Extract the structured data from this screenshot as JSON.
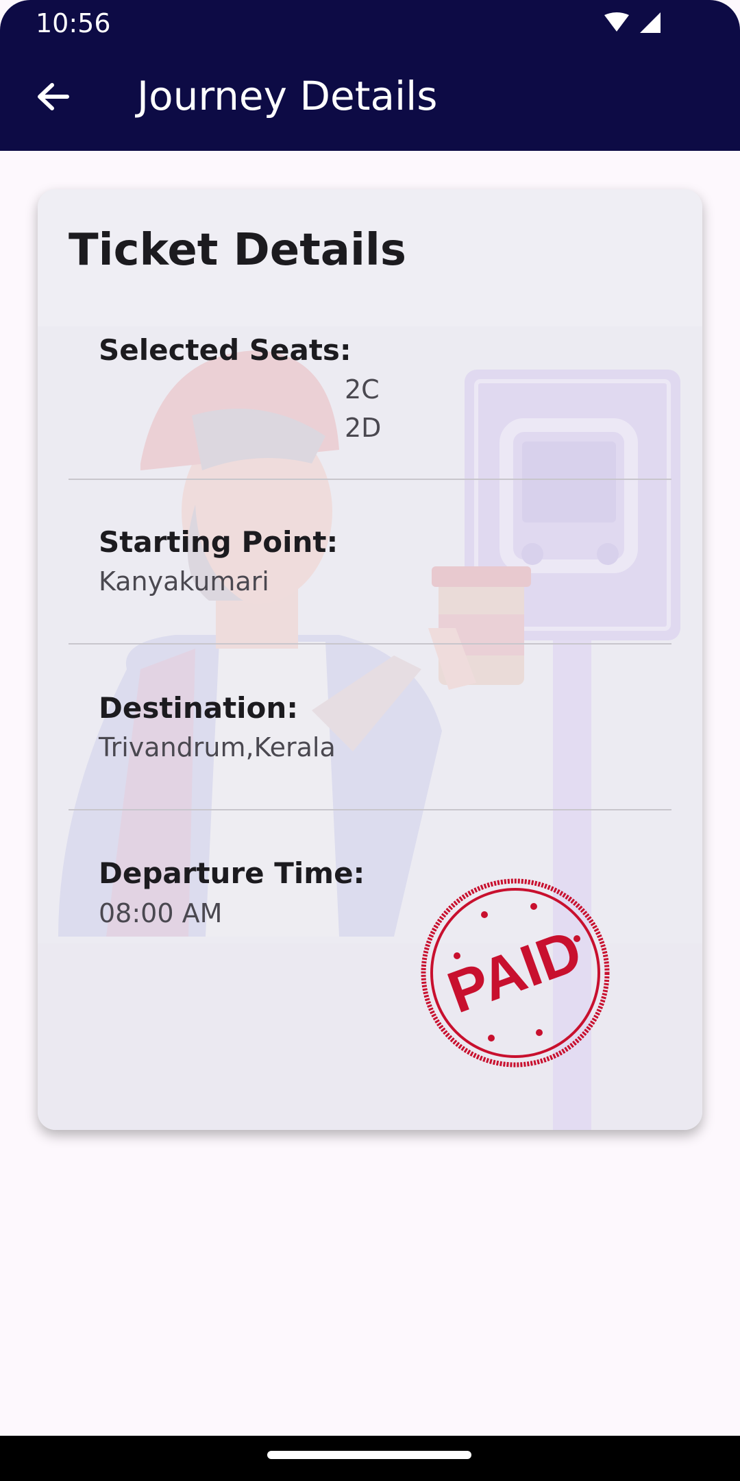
{
  "status_bar": {
    "time": "10:56"
  },
  "app_bar": {
    "title": "Journey Details",
    "back_icon": "arrow-left-icon"
  },
  "card": {
    "title": "Ticket Details",
    "selected_seats": {
      "label": "Selected Seats:",
      "seats": [
        "2C",
        "2D"
      ]
    },
    "starting_point": {
      "label": "Starting Point:",
      "value": "Kanyakumari"
    },
    "destination": {
      "label": "Destination:",
      "value": "Trivandrum,Kerala"
    },
    "departure_time": {
      "label": "Departure Time:",
      "value": "08:00 AM"
    },
    "stamp": {
      "text": "PAID",
      "color": "#c8102e"
    }
  },
  "colors": {
    "app_bar": "#0d0b45",
    "card": "#ecebf2",
    "background": "#fdf8fd"
  }
}
